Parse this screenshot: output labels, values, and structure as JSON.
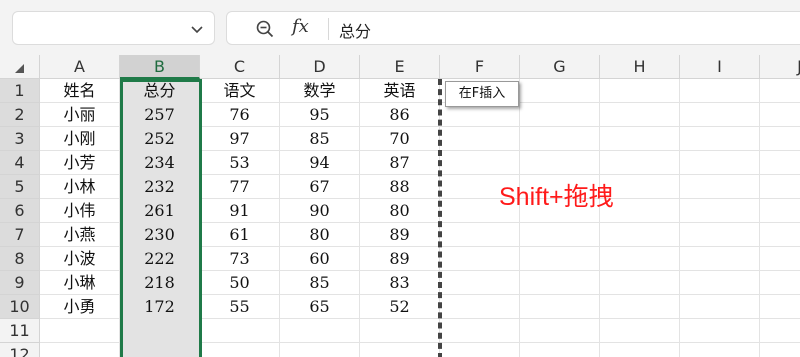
{
  "namebox": {
    "value": "",
    "icon": "chevron-down-icon"
  },
  "formula": {
    "zoom_icon": "zoom-icon",
    "fx_label": "fx",
    "content": "总分"
  },
  "columns": [
    "A",
    "B",
    "C",
    "D",
    "E",
    "F",
    "G",
    "H",
    "I",
    "J"
  ],
  "selected_column": "B",
  "rows": [
    [
      "姓名",
      "总分",
      "语文",
      "数学",
      "英语"
    ],
    [
      "小丽",
      "257",
      "76",
      "95",
      "86"
    ],
    [
      "小刚",
      "252",
      "97",
      "85",
      "70"
    ],
    [
      "小芳",
      "234",
      "53",
      "94",
      "87"
    ],
    [
      "小林",
      "232",
      "77",
      "67",
      "88"
    ],
    [
      "小伟",
      "261",
      "91",
      "90",
      "80"
    ],
    [
      "小燕",
      "230",
      "61",
      "80",
      "89"
    ],
    [
      "小波",
      "222",
      "73",
      "60",
      "89"
    ],
    [
      "小琳",
      "218",
      "50",
      "85",
      "83"
    ],
    [
      "小勇",
      "172",
      "55",
      "65",
      "52"
    ],
    [
      "",
      "",
      "",
      "",
      ""
    ],
    [
      "",
      "",
      "",
      "",
      ""
    ]
  ],
  "row_numbers": [
    "1",
    "2",
    "3",
    "4",
    "5",
    "6",
    "7",
    "8",
    "9",
    "10",
    "11",
    "12"
  ],
  "tooltip": "在F插入",
  "annotation": "Shift+拖拽",
  "colors": {
    "selection": "#1f7a48",
    "annotation": "#ff1a1a"
  }
}
